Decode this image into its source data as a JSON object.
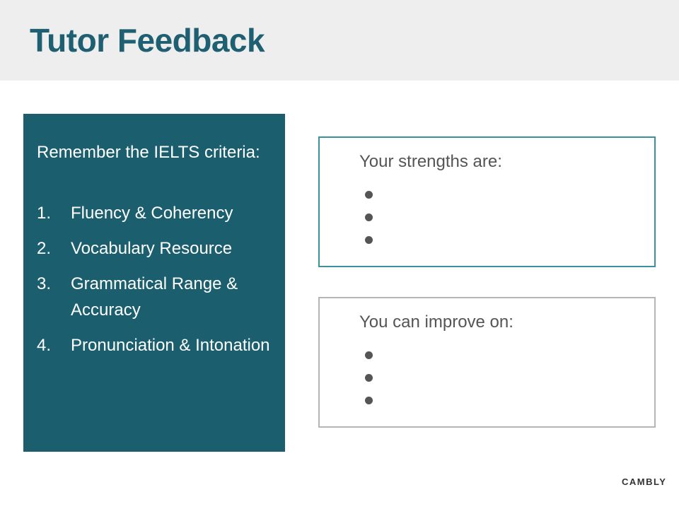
{
  "header": {
    "title": "Tutor Feedback"
  },
  "criteria": {
    "intro": "Remember the IELTS criteria:",
    "items": [
      {
        "num": "1.",
        "text": "Fluency & Coherency"
      },
      {
        "num": "2.",
        "text": "Vocabulary Resource"
      },
      {
        "num": "3.",
        "text": "Grammatical Range & Accuracy"
      },
      {
        "num": "4.",
        "text": "Pronunciation & Intonation"
      }
    ]
  },
  "strengths": {
    "heading": "Your strengths are:"
  },
  "improve": {
    "heading": "You can improve on:"
  },
  "brand": {
    "logo": "CAMBLY"
  },
  "colors": {
    "accent": "#1b5e6e",
    "title": "#1e6072",
    "strengths_border": "#3a929a"
  }
}
